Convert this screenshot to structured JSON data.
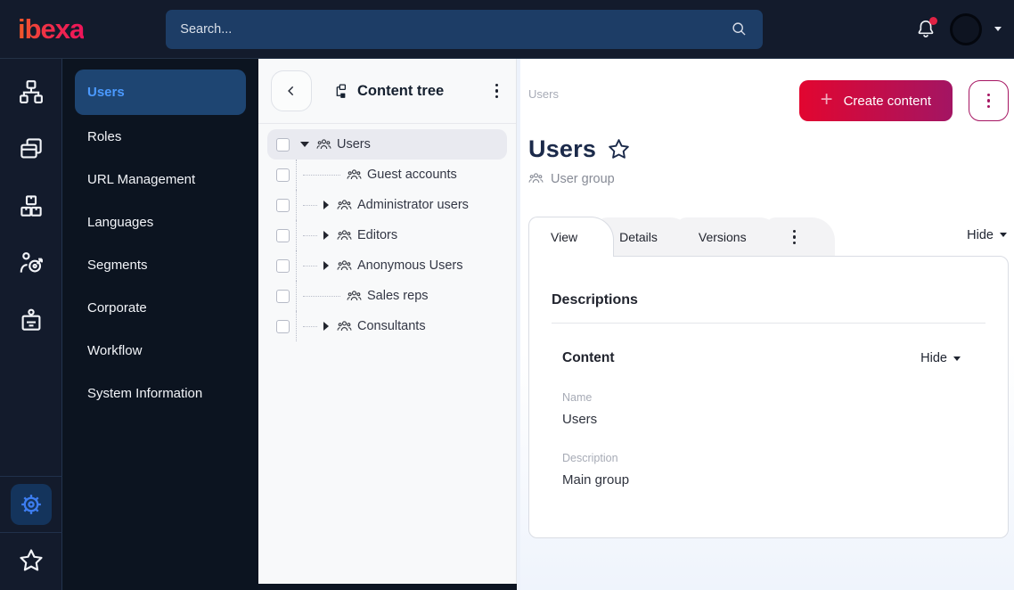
{
  "topbar": {
    "logo_text": "ibexa",
    "search": {
      "placeholder": "Search...",
      "icon": "search-icon"
    },
    "bell_icon": "bell-icon",
    "notification_dot_color": "#e02244",
    "avatar_icon": "user-avatar",
    "caret_icon": "chevron-down-icon"
  },
  "iconbar": {
    "items": [
      {
        "icon": "sitemap-icon"
      },
      {
        "icon": "pages-icon"
      },
      {
        "icon": "products-icon"
      },
      {
        "icon": "personalization-icon"
      },
      {
        "icon": "badge-icon"
      }
    ],
    "bottom_items": [
      {
        "icon": "gear-icon",
        "selected": true,
        "accent": "#3d7df0"
      },
      {
        "icon": "star-icon",
        "selected": false
      }
    ]
  },
  "sidenav": {
    "items": [
      {
        "label": "Users",
        "selected": true
      },
      {
        "label": "Roles",
        "selected": false
      },
      {
        "label": "URL Management",
        "selected": false
      },
      {
        "label": "Languages",
        "selected": false
      },
      {
        "label": "Segments",
        "selected": false
      },
      {
        "label": "Corporate",
        "selected": false
      },
      {
        "label": "Workflow",
        "selected": false
      },
      {
        "label": "System Information",
        "selected": false
      }
    ],
    "selected_bg": "#1e4572",
    "selected_color": "#4b9aff"
  },
  "tree": {
    "back_icon": "chevron-left-icon",
    "title_icon": "content-tree-icon",
    "title": "Content tree",
    "menu_icon": "kebab-menu-icon",
    "items": [
      {
        "label": "Users",
        "state": "expanded",
        "depth": 0,
        "selected": true,
        "icon": "user-group-icon",
        "checkbox": false
      },
      {
        "label": "Guest accounts",
        "state": "leaf",
        "depth": 1,
        "selected": false,
        "icon": "user-group-icon",
        "checkbox": false
      },
      {
        "label": "Administrator users",
        "state": "collapsed",
        "depth": 1,
        "selected": false,
        "icon": "user-group-icon",
        "checkbox": false
      },
      {
        "label": "Editors",
        "state": "collapsed",
        "depth": 1,
        "selected": false,
        "icon": "user-group-icon",
        "checkbox": false
      },
      {
        "label": "Anonymous Users",
        "state": "collapsed",
        "depth": 1,
        "selected": false,
        "icon": "user-group-icon",
        "checkbox": false
      },
      {
        "label": "Sales reps",
        "state": "leaf",
        "depth": 1,
        "selected": false,
        "icon": "user-group-icon",
        "checkbox": false
      },
      {
        "label": "Consultants",
        "state": "collapsed",
        "depth": 1,
        "selected": false,
        "icon": "user-group-icon",
        "checkbox": false
      }
    ]
  },
  "main": {
    "breadcrumb": "Users",
    "create_button": {
      "label": "Create content",
      "plus_char": "+",
      "gradient": [
        "#e20630",
        "#a31563"
      ]
    },
    "more_button_icon": "kebab-menu-icon",
    "title": "Users",
    "title_star_icon": "star-icon",
    "content_type": {
      "icon": "user-group-icon",
      "label": "User group"
    },
    "tabs": [
      {
        "label": "View",
        "active": true
      },
      {
        "label": "Details",
        "active": false
      },
      {
        "label": "Versions",
        "active": false
      },
      {
        "label": "",
        "icon": "kebab-menu-icon",
        "active": false
      }
    ],
    "hide_toggle": {
      "label": "Hide",
      "icon": "caret-down-icon"
    },
    "card": {
      "heading": "Descriptions",
      "section": {
        "title": "Content",
        "hide_toggle": {
          "label": "Hide",
          "icon": "caret-down-icon"
        }
      },
      "fields": [
        {
          "label": "Name",
          "value": "Users"
        },
        {
          "label": "Description",
          "value": "Main group"
        }
      ]
    }
  }
}
